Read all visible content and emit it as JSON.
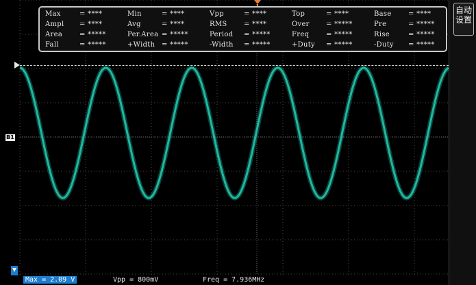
{
  "colors": {
    "trace": "#1fb8a0",
    "grid": "#4a4a4a",
    "highlight": "#1c7ccf",
    "trigger_marker": "#e8803a"
  },
  "measurements": [
    [
      {
        "label": "Max",
        "value": "= ****"
      },
      {
        "label": "Min",
        "value": "= ****"
      },
      {
        "label": "Vpp",
        "value": "= ****"
      },
      {
        "label": "Top",
        "value": "= ****"
      },
      {
        "label": "Base",
        "value": "= ****"
      }
    ],
    [
      {
        "label": "Ampl",
        "value": "= ****"
      },
      {
        "label": "Avg",
        "value": "= ****"
      },
      {
        "label": "RMS",
        "value": "= ****"
      },
      {
        "label": "Over",
        "value": "= *****"
      },
      {
        "label": "Pre",
        "value": "= *****"
      }
    ],
    [
      {
        "label": "Area",
        "value": "= *****"
      },
      {
        "label": "Per.Area",
        "value": "= *****"
      },
      {
        "label": "Period",
        "value": "= *****"
      },
      {
        "label": "Freq",
        "value": "= *****"
      },
      {
        "label": "Rise",
        "value": "= *****"
      }
    ],
    [
      {
        "label": "Fall",
        "value": "= *****"
      },
      {
        "label": "+Width",
        "value": "= *****"
      },
      {
        "label": "-Width",
        "value": "= *****"
      },
      {
        "label": "+Duty",
        "value": "= *****"
      },
      {
        "label": "-Duty",
        "value": "= *****"
      }
    ]
  ],
  "side_menu": {
    "button_label": "自动\n设置"
  },
  "channel_marker": "B1",
  "status": {
    "max": "Max = 2.09 V",
    "vpp": "Vpp = 800mV",
    "freq": "Freq = 7.936MHz"
  },
  "waveform": {
    "type": "sine",
    "cycles": 5,
    "frequency_text": "7.936MHz"
  }
}
